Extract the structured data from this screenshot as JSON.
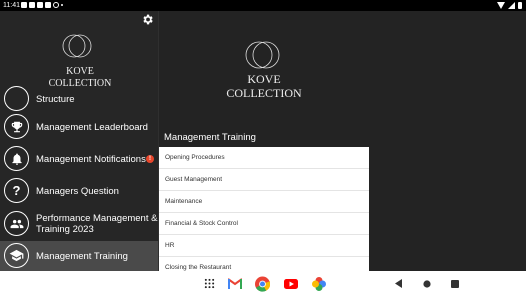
{
  "status_bar": {
    "time": "11:41",
    "icons": [
      "file-icon",
      "message-icon",
      "message-icon",
      "message-icon",
      "circle-icon",
      "dot-icon"
    ],
    "right_icons": [
      "wifi-icon",
      "signal-icon",
      "battery-icon"
    ]
  },
  "sidebar": {
    "settings_icon": "gear-icon",
    "logo_text_line1": "KOVE",
    "logo_text_line2": "COLLECTION",
    "items": [
      {
        "label": "Structure",
        "icon": "structure-icon"
      },
      {
        "label": "Management Leaderboard",
        "icon": "trophy-icon"
      },
      {
        "label": "Management Notifications",
        "icon": "bell-icon",
        "badge": "!"
      },
      {
        "label": "Managers Question",
        "icon": "question-icon"
      },
      {
        "label": "Performance Management & Training 2023",
        "label_line1": "Performance Management &",
        "label_line2": "Training 2023",
        "icon": "people-icon"
      },
      {
        "label": "Management Training",
        "icon": "graduation-cap-icon",
        "active": true
      }
    ]
  },
  "main": {
    "logo_text_line1": "KOVE",
    "logo_text_line2": "COLLECTION",
    "section_title": "Management Training",
    "list_items": [
      "Opening Procedures",
      "Guest Management",
      "Maintenance",
      "Financial & Stock Control",
      "HR",
      "Closing the Restaurant"
    ]
  },
  "nav_bar": {
    "apps": [
      "apps-grid-icon",
      "gmail-icon",
      "chrome-icon",
      "youtube-icon",
      "photos-icon"
    ],
    "system": [
      "back-icon",
      "home-icon",
      "recents-icon"
    ]
  },
  "colors": {
    "sidebar_bg": "#262626",
    "main_bg": "#232323",
    "active_item_bg": "#4a4a4a",
    "alert": "#e8472c"
  }
}
